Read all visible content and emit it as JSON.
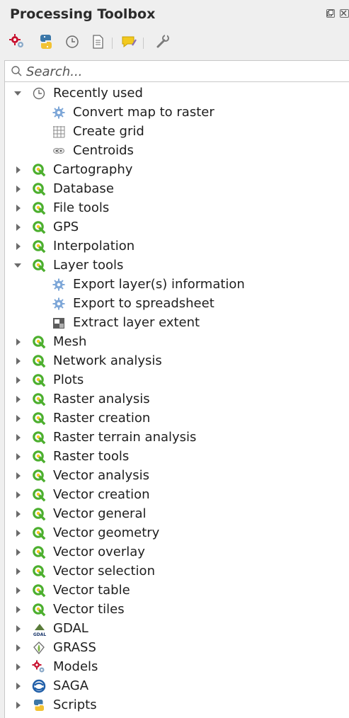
{
  "panel": {
    "title": "Processing Toolbox"
  },
  "toolbar": {
    "buttons": [
      "models-icon",
      "python-icon",
      "history-icon",
      "results-icon",
      "edit-features-icon",
      "options-icon"
    ]
  },
  "search": {
    "placeholder": "Search..."
  },
  "tree": {
    "recently_used": {
      "label": "Recently used",
      "children": [
        {
          "label": "Convert map to raster",
          "icon": "gear-icon"
        },
        {
          "label": "Create grid",
          "icon": "grid-icon"
        },
        {
          "label": "Centroids",
          "icon": "centroids-icon"
        }
      ]
    },
    "groups_a": [
      {
        "label": "Cartography"
      },
      {
        "label": "Database"
      },
      {
        "label": "File tools"
      },
      {
        "label": "GPS"
      },
      {
        "label": "Interpolation"
      }
    ],
    "layer_tools": {
      "label": "Layer tools",
      "children": [
        {
          "label": "Export layer(s) information",
          "icon": "gear-icon"
        },
        {
          "label": "Export to spreadsheet",
          "icon": "gear-icon"
        },
        {
          "label": "Extract layer extent",
          "icon": "extent-icon"
        }
      ]
    },
    "groups_b": [
      {
        "label": "Mesh"
      },
      {
        "label": "Network analysis"
      },
      {
        "label": "Plots"
      },
      {
        "label": "Raster analysis"
      },
      {
        "label": "Raster creation"
      },
      {
        "label": "Raster terrain analysis"
      },
      {
        "label": "Raster tools"
      },
      {
        "label": "Vector analysis"
      },
      {
        "label": "Vector creation"
      },
      {
        "label": "Vector general"
      },
      {
        "label": "Vector geometry"
      },
      {
        "label": "Vector overlay"
      },
      {
        "label": "Vector selection"
      },
      {
        "label": "Vector table"
      },
      {
        "label": "Vector tiles"
      }
    ],
    "providers": [
      {
        "label": "GDAL",
        "icon": "gdal-icon"
      },
      {
        "label": "GRASS",
        "icon": "grass-icon"
      },
      {
        "label": "Models",
        "icon": "models-icon"
      },
      {
        "label": "SAGA",
        "icon": "saga-icon"
      },
      {
        "label": "Scripts",
        "icon": "python-icon"
      }
    ]
  },
  "colors": {
    "qgis_green": "#4caf2e",
    "gear_blue": "#7ea7d8",
    "background": "#efefef"
  }
}
